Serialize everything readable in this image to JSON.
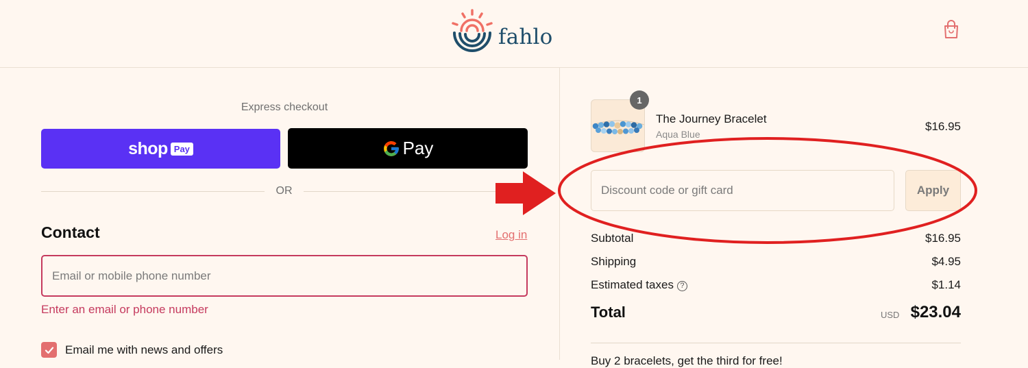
{
  "header": {
    "brand": "fahlo",
    "cart_icon": "shopping-bag-icon"
  },
  "express": {
    "label": "Express checkout",
    "shop_pay_brand": "shop",
    "shop_pay_badge": "Pay",
    "google_pay_label": "Pay",
    "or_label": "OR"
  },
  "contact": {
    "title": "Contact",
    "login_label": "Log in",
    "email_placeholder": "Email or mobile phone number",
    "email_value": "",
    "error_text": "Enter an email or phone number",
    "newsletter_label": "Email me with news and offers",
    "newsletter_checked": true
  },
  "order": {
    "item": {
      "name": "The Journey Bracelet",
      "variant": "Aqua Blue",
      "price": "$16.95",
      "quantity": "1"
    },
    "discount_placeholder": "Discount code or gift card",
    "apply_label": "Apply",
    "subtotal_label": "Subtotal",
    "subtotal_value": "$16.95",
    "shipping_label": "Shipping",
    "shipping_value": "$4.95",
    "taxes_label": "Estimated taxes",
    "taxes_value": "$1.14",
    "total_label": "Total",
    "total_currency": "USD",
    "total_value": "$23.04",
    "promo_text": "Buy 2 bracelets, get the third for free!"
  },
  "colors": {
    "background": "#fff7f0",
    "shop_pay": "#5a31f4",
    "accent_coral": "#e36f6f",
    "error": "#c53a5e",
    "brand_navy": "#1f4e6b",
    "annotation_red": "#e02020"
  }
}
